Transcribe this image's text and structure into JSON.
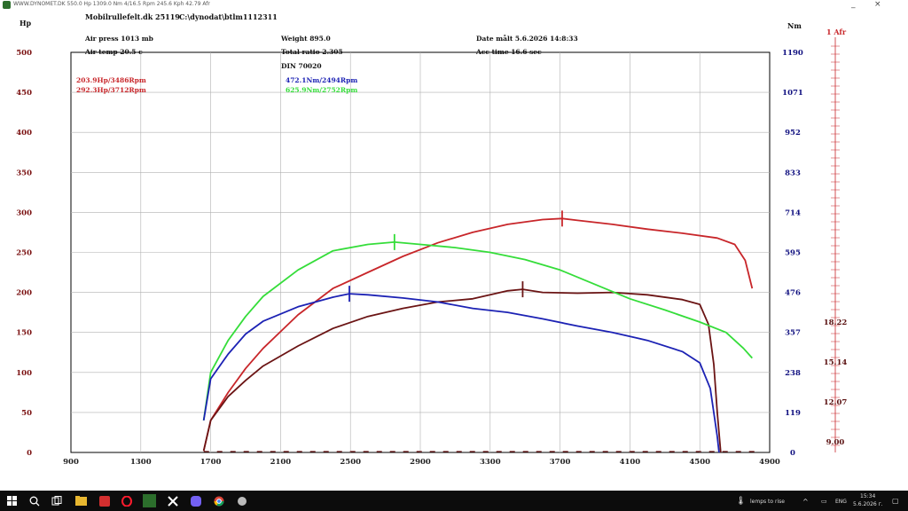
{
  "window": {
    "title": "WWW.DYNOMET.DK  550.0 Hp 1309.0 Nm 4/16.5 Rpm 245.6 Kph    42.79 Afr",
    "minimize": "_",
    "close": "×"
  },
  "chart_data": {
    "type": "line",
    "header": {
      "file": "Mobilrullefelt.dk 25119",
      "path": "C:\\dynodat\\btlm1112311",
      "air_press": "Air press  1013 mb",
      "air_temp": "Air temp  20.5 c",
      "weight": "Weight   895.0",
      "ratio": "Total ratio 2.305",
      "standard": "DIN 70020",
      "date": "Date målt 5.6.2026 14:8:33",
      "acc_time": "Acc time  16.6 sec"
    },
    "ylabel_left": "Hp",
    "ylabel_right": "Nm",
    "ylabel_afr": "1 Afr",
    "x_ticks": [
      900,
      1300,
      1700,
      2100,
      2500,
      2900,
      3300,
      3700,
      4100,
      4500,
      4900
    ],
    "xlim": [
      900,
      4900
    ],
    "y_left_ticks": [
      0,
      50,
      100,
      150,
      200,
      250,
      300,
      350,
      400,
      450,
      500
    ],
    "ylim_left": [
      0,
      500
    ],
    "y_right_ticks": [
      0,
      119,
      238,
      357,
      476,
      595,
      714,
      833,
      952,
      1071,
      1190
    ],
    "afr_ticks": [
      "18.22",
      "15.14",
      "12.07",
      "9.00"
    ],
    "legend_power": [
      "203.9Hp/3486Rpm",
      "292.3Hp/3712Rpm"
    ],
    "legend_torque": [
      "472.1Nm/2494Rpm",
      "625.9Nm/2752Rpm"
    ],
    "grid": true,
    "colors": {
      "red": "#c8262a",
      "darkred": "#6b1414",
      "blue": "#1c22b4",
      "green": "#35dd3a",
      "axis_left": "#7a1010",
      "axis_right": "#101080"
    },
    "series": [
      {
        "name": "292.3Hp/3712Rpm",
        "color": "#c8262a",
        "axis": "left",
        "x": [
          1660,
          1700,
          1800,
          1900,
          2000,
          2200,
          2400,
          2600,
          2800,
          3000,
          3200,
          3400,
          3600,
          3712,
          3800,
          4000,
          4200,
          4400,
          4600,
          4700,
          4760,
          4800
        ],
        "y": [
          2,
          40,
          75,
          105,
          130,
          172,
          205,
          225,
          245,
          262,
          275,
          285,
          291,
          292.3,
          290,
          285,
          279,
          274,
          268,
          260,
          240,
          205
        ]
      },
      {
        "name": "203.9Hp/3486Rpm",
        "color": "#6b1414",
        "axis": "left",
        "x": [
          1660,
          1700,
          1800,
          1900,
          2000,
          2200,
          2400,
          2600,
          2800,
          3000,
          3200,
          3300,
          3400,
          3486,
          3600,
          3800,
          4000,
          4200,
          4400,
          4500,
          4550,
          4580,
          4600,
          4620
        ],
        "y": [
          2,
          40,
          70,
          90,
          108,
          133,
          155,
          170,
          180,
          188,
          192,
          197,
          202,
          203.9,
          200,
          199,
          200,
          197,
          191,
          185,
          160,
          110,
          50,
          0
        ]
      },
      {
        "name": "625.9Nm/2752Rpm",
        "color": "#35dd3a",
        "axis": "left",
        "x": [
          1660,
          1700,
          1800,
          1900,
          2000,
          2200,
          2400,
          2600,
          2752,
          2900,
          3100,
          3300,
          3500,
          3700,
          3900,
          4100,
          4300,
          4500,
          4650,
          4750,
          4800
        ],
        "y": [
          40,
          100,
          140,
          170,
          195,
          228,
          252,
          260,
          262.9,
          260,
          256,
          250,
          241,
          228,
          210,
          192,
          178,
          163,
          150,
          130,
          118
        ]
      },
      {
        "name": "472.1Nm/2494Rpm",
        "color": "#1c22b4",
        "axis": "left",
        "x": [
          1660,
          1700,
          1800,
          1900,
          2000,
          2200,
          2400,
          2494,
          2600,
          2800,
          3000,
          3200,
          3400,
          3600,
          3800,
          4000,
          4200,
          4400,
          4500,
          4560,
          4600,
          4610
        ],
        "y": [
          40,
          92,
          123,
          148,
          164,
          182,
          194,
          198.3,
          197,
          193,
          188,
          180,
          175,
          167,
          158,
          150,
          140,
          126,
          112,
          80,
          20,
          0
        ]
      }
    ],
    "peaks": [
      {
        "series": 0,
        "x": 3712,
        "y": 292.3
      },
      {
        "series": 1,
        "x": 3486,
        "y": 203.9
      },
      {
        "series": 2,
        "x": 2752,
        "y": 262.9
      },
      {
        "series": 3,
        "x": 2494,
        "y": 198.3
      }
    ]
  },
  "taskbar": {
    "icons": [
      "windows-start-icon",
      "search-icon",
      "task-view-icon",
      "file-explorer-icon",
      "app-icon",
      "opera-icon",
      "dyno-app-icon",
      "excel-icon",
      "viber-icon",
      "chrome-icon",
      "app-icon-2"
    ],
    "weather": "lemps to rise",
    "lang": "ENG",
    "time": "15:34",
    "date": "5.6.2026 г."
  }
}
